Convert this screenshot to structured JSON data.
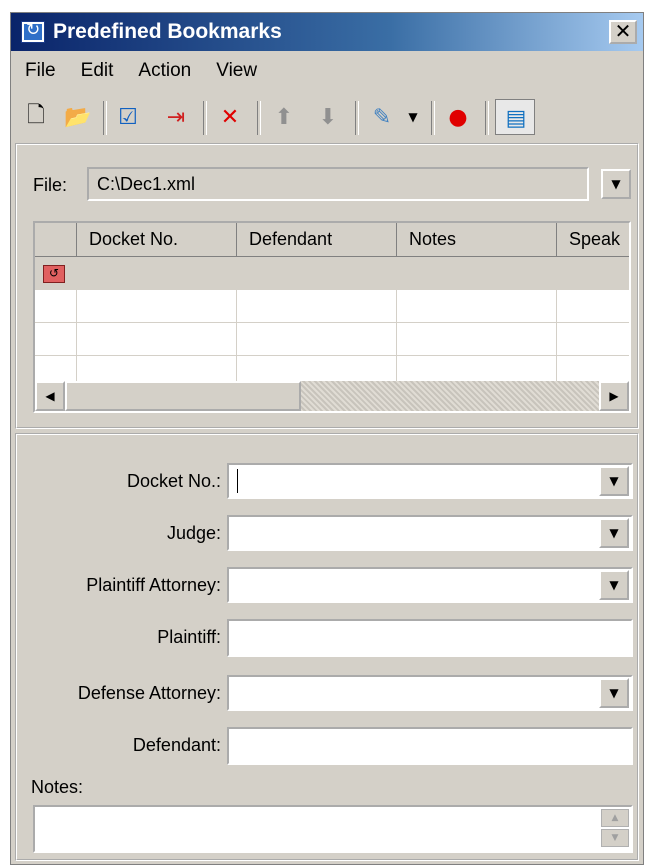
{
  "window": {
    "title": "Predefined Bookmarks",
    "close_label": "✕"
  },
  "menu": [
    "File",
    "Edit",
    "Action",
    "View"
  ],
  "toolbar": {
    "icons": [
      "new-icon",
      "open-folder-icon",
      "check-document-icon",
      "export-document-icon",
      "delete-icon",
      "move-up-icon",
      "move-down-icon",
      "highlight-icon",
      "dropdown-arrow-icon",
      "bookmark-record-icon",
      "panel-toggle-icon"
    ]
  },
  "file": {
    "label": "File:",
    "value": "C:\\Dec1.xml"
  },
  "grid": {
    "columns": [
      "",
      "Docket No.",
      "Defendant",
      "Notes",
      "Speak"
    ],
    "rows": 4
  },
  "form": {
    "docket_label": "Docket No.:",
    "judge_label": "Judge:",
    "plaintiff_attorney_label": "Plaintiff Attorney:",
    "plaintiff_label": "Plaintiff:",
    "defense_attorney_label": "Defense Attorney:",
    "defendant_label": "Defendant:",
    "notes_label": "Notes:"
  },
  "colors": {
    "titlebar_start": "#0a246a",
    "titlebar_end": "#a6caf0",
    "face": "#d4d0c8"
  }
}
